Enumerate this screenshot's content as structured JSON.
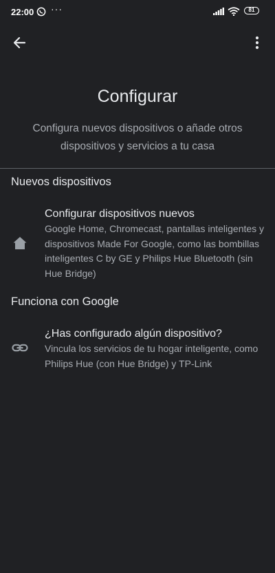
{
  "status_bar": {
    "time": "22:00",
    "dots": "···",
    "battery": "81"
  },
  "header": {
    "title": "Configurar",
    "subtitle": "Configura nuevos dispositivos o añade otros dispositivos y servicios a tu casa"
  },
  "sections": [
    {
      "header": "Nuevos dispositivos",
      "item": {
        "icon": "home-icon",
        "title": "Configurar dispositivos nuevos",
        "description": "Google Home, Chromecast, pantallas inteligentes y dispositivos Made For Google, como las bombillas inteligentes C by GE y Philips Hue Bluetooth (sin Hue Bridge)"
      }
    },
    {
      "header": "Funciona con Google",
      "item": {
        "icon": "link-icon",
        "title": "¿Has configurado algún dispositivo?",
        "description": "Vincula los servicios de tu hogar inteligente, como Philips Hue (con Hue Bridge) y TP-Link"
      }
    }
  ],
  "colors": {
    "background": "#202124",
    "primary_text": "#e8eaed",
    "secondary_text": "#a9adb3",
    "icon": "#9aa0a6"
  }
}
